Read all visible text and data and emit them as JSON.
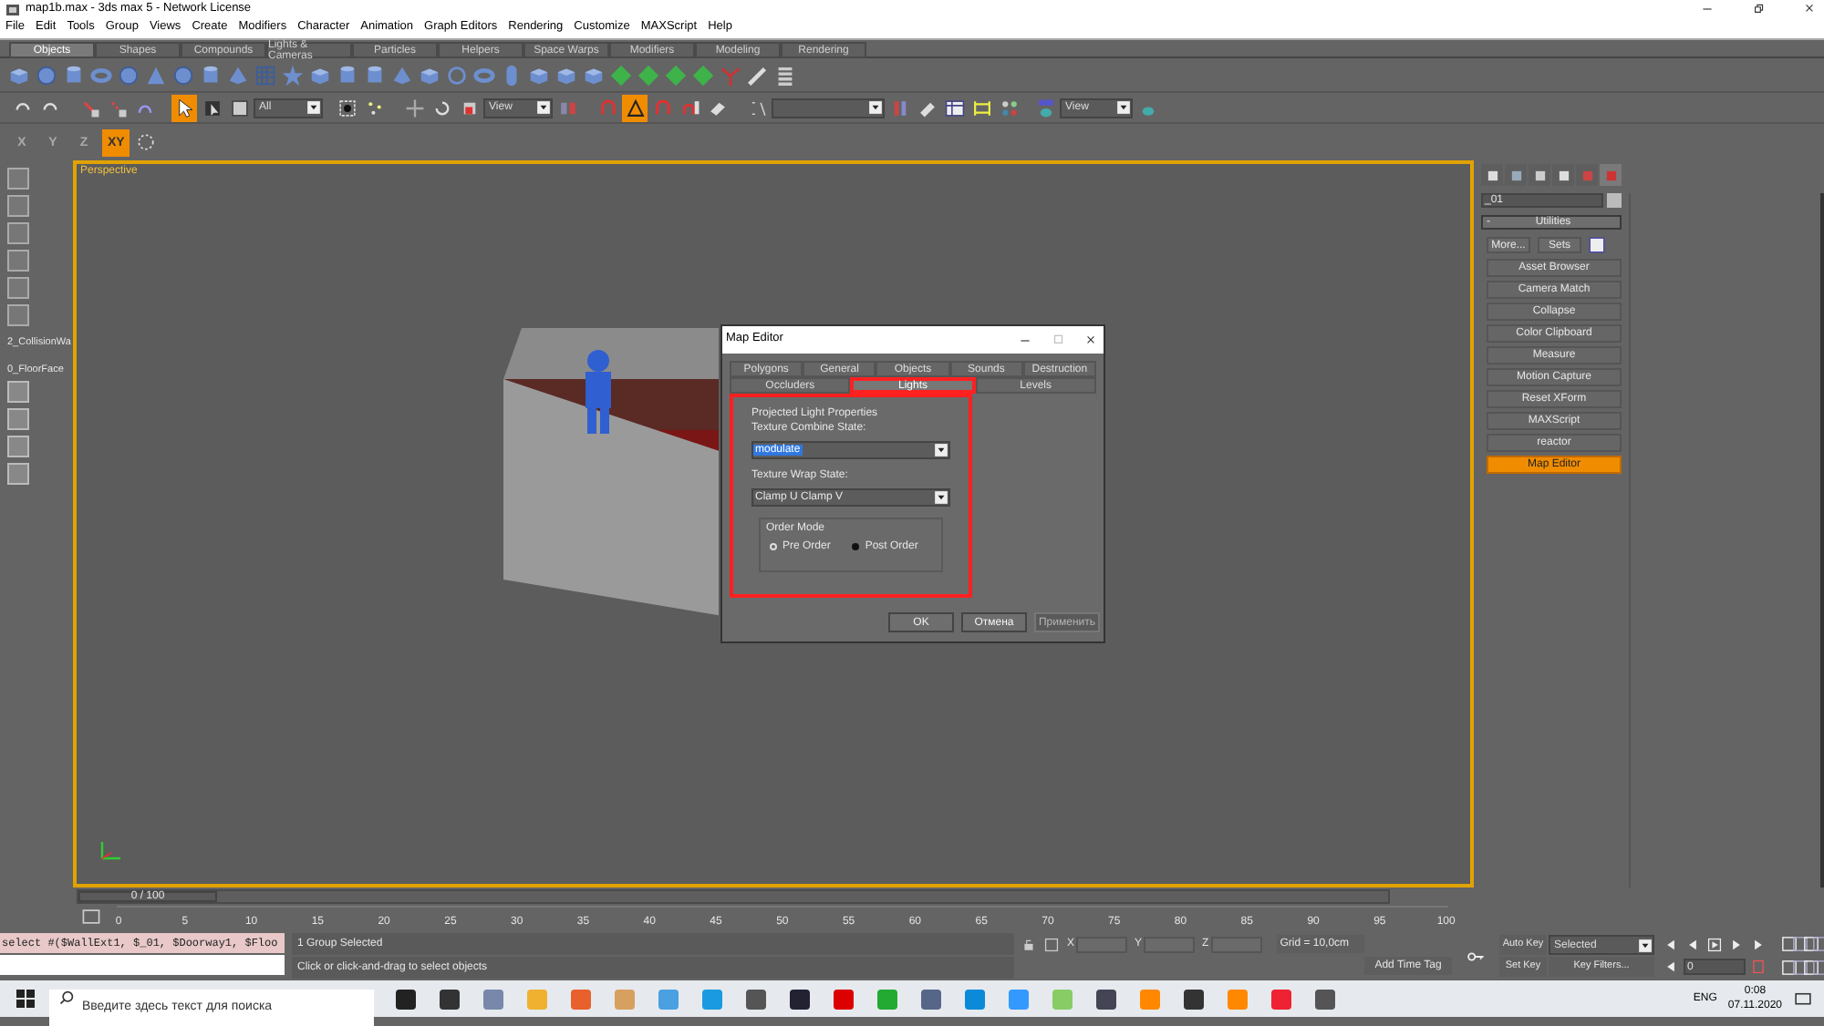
{
  "window": {
    "title": "map1b.max - 3ds max 5 - Network License"
  },
  "menu": [
    "File",
    "Edit",
    "Tools",
    "Group",
    "Views",
    "Create",
    "Modifiers",
    "Character",
    "Animation",
    "Graph Editors",
    "Rendering",
    "Customize",
    "MAXScript",
    "Help"
  ],
  "command_tabs": [
    {
      "label": "Objects",
      "selected": true
    },
    {
      "label": "Shapes",
      "selected": false
    },
    {
      "label": "Compounds",
      "selected": false
    },
    {
      "label": "Lights & Cameras",
      "selected": false
    },
    {
      "label": "Particles",
      "selected": false
    },
    {
      "label": "Helpers",
      "selected": false
    },
    {
      "label": "Space Warps",
      "selected": false
    },
    {
      "label": "Modifiers",
      "selected": false
    },
    {
      "label": "Modeling",
      "selected": false
    },
    {
      "label": "Rendering",
      "selected": false
    }
  ],
  "main_toolbar": {
    "selection_filter": "All",
    "reference_coord": "View",
    "render_view": "View",
    "select_mode": {
      "on": true
    },
    "angle_snap": {
      "on": true
    }
  },
  "axis_buttons": [
    {
      "label": "X",
      "selected": false
    },
    {
      "label": "Y",
      "selected": false
    },
    {
      "label": "Z",
      "selected": false
    },
    {
      "label": "XY",
      "selected": true
    }
  ],
  "left_toolbar": {
    "labels": [
      "2_CollisionWa",
      "0_FloorFace"
    ]
  },
  "viewport": {
    "label": "Perspective"
  },
  "dialog": {
    "title": "Map Editor",
    "tab_rows": [
      [
        {
          "label": "Polygons",
          "selected": false,
          "annotated": false
        },
        {
          "label": "General",
          "selected": false,
          "annotated": false
        },
        {
          "label": "Objects",
          "selected": false,
          "annotated": false
        },
        {
          "label": "Sounds",
          "selected": false,
          "annotated": false
        },
        {
          "label": "Destruction",
          "selected": false,
          "annotated": false
        }
      ],
      [
        {
          "label": "Occluders",
          "selected": false,
          "annotated": false
        },
        {
          "label": "Lights",
          "selected": true,
          "annotated": true
        },
        {
          "label": "Levels",
          "selected": false,
          "annotated": false
        }
      ]
    ],
    "group": {
      "title": "Projected Light Properties",
      "annotated": true,
      "combine_label": "Texture Combine State:",
      "combine_value": "modulate",
      "wrap_label": "Texture Wrap State:",
      "wrap_value": "Clamp U Clamp V",
      "order": {
        "title": "Order Mode",
        "options": [
          {
            "label": "Pre Order",
            "selected": false
          },
          {
            "label": "Post Order",
            "selected": true
          }
        ]
      }
    },
    "buttons": [
      {
        "label": "OK",
        "disabled": false
      },
      {
        "label": "Отмена",
        "disabled": false
      },
      {
        "label": "Применить",
        "disabled": true
      }
    ]
  },
  "command_panel": {
    "tabs": [
      {
        "selected": false
      },
      {
        "selected": false
      },
      {
        "selected": false
      },
      {
        "selected": false
      },
      {
        "selected": false
      },
      {
        "selected": true
      }
    ],
    "object_name": "_01",
    "rollout": {
      "toggle": "-",
      "title": "Utilities"
    },
    "buttons": [
      "More...",
      "Sets"
    ],
    "utilities": [
      {
        "label": "Asset Browser",
        "selected": false
      },
      {
        "label": "Camera Match",
        "selected": false
      },
      {
        "label": "Collapse",
        "selected": false
      },
      {
        "label": "Color Clipboard",
        "selected": false
      },
      {
        "label": "Measure",
        "selected": false
      },
      {
        "label": "Motion Capture",
        "selected": false
      },
      {
        "label": "Reset XForm",
        "selected": false
      },
      {
        "label": "MAXScript",
        "selected": false
      },
      {
        "label": "reactor",
        "selected": false
      },
      {
        "label": "Map Editor",
        "selected": true
      }
    ]
  },
  "timeline": {
    "slider": {
      "label": "0 / 100",
      "level": 0
    },
    "ruler": [
      "0",
      "5",
      "10",
      "15",
      "20",
      "25",
      "30",
      "35",
      "40",
      "45",
      "50",
      "55",
      "60",
      "65",
      "70",
      "75",
      "80",
      "85",
      "90",
      "95",
      "100"
    ]
  },
  "status": {
    "listener_command": "select #($WallExt1, $_01, $Doorway1, $Floo",
    "selection": "1 Group Selected",
    "prompt": "Click or click-and-drag to select objects",
    "coord_labels": [
      "X",
      "Y",
      "Z"
    ],
    "grid": "Grid = 10,0cm",
    "time_tag": "Add Time Tag",
    "auto_key": "Auto Key",
    "key_mode": "Selected",
    "set_key": "Set Key",
    "key_filters": "Key Filters...",
    "frame": "0"
  },
  "taskbar": {
    "search_placeholder": "Введите здесь текст для поиска",
    "language": "ENG",
    "time": "0:08",
    "date": "07.11.2020"
  }
}
